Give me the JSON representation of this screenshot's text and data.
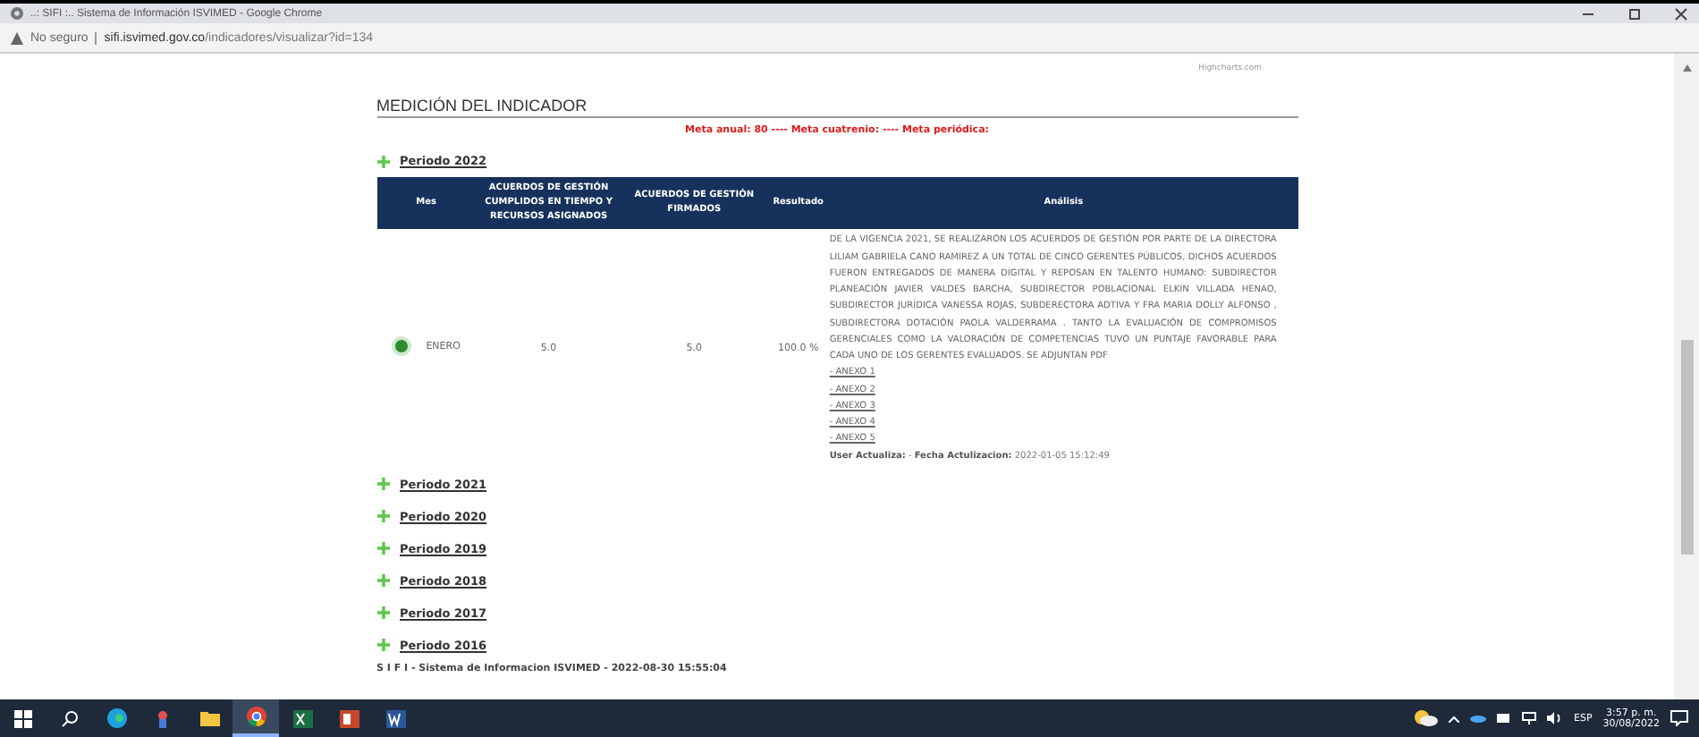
{
  "window": {
    "title": "..: SIFI :.. Sistema de Información ISVIMED - Google Chrome"
  },
  "address_bar": {
    "security": "No seguro",
    "host": "sifi.isvimed.gov.co",
    "path": "/indicadores/visualizar?id=134"
  },
  "chart_credit": "Highcharts.com",
  "section_title": "MEDICIÓN DEL INDICADOR",
  "goals": "Meta anual: 80 ---- Meta cuatrenio: ---- Meta periódica:",
  "periods": [
    {
      "label": "Periodo 2022",
      "table": {
        "columns": [
          "Mes",
          "ACUERDOS DE GESTIÓN CUMPLIDOS EN TIEMPO Y RECURSOS ASIGNADOS",
          "ACUERDOS DE GESTIÓN FIRMADOS",
          "Resultado",
          "Análisis"
        ],
        "rows": [
          {
            "color": "#2e8b2e",
            "mes": "ENERO",
            "cumplidos": "5.0",
            "firmados": "5.0",
            "resultado": "100.0 %",
            "analisis": "DE LA VIGENCIA 2021, SE REALIZARON LOS ACUERDOS DE GESTIÓN POR PARTE DE LA DIRECTORA LILIAM GABRIELA CANO RAMIREZ A UN TOTAL DE CINCO GERENTES PÚBLICOS, DICHOS ACUERDOS FUERON ENTREGADOS DE MANERA DIGITAL Y REPOSAN EN TALENTO HUMANO: SUBDIRECTOR PLANEACIÓN JAVIER VALDES BARCHA, SUBDIRECTOR POBLACIONAL ELKIN VILLADA HENAO, SUBDIRECTOR JURÍDICA VANESSA ROJAS, SUBDERECTORA ADTIVA Y FRA MARIA DOLLY ALFONSO , SUBDIRECTORA DOTACIÓN PAOLA VALDERRAMA . TANTO LA EVALUACIÓN DE COMPROMISOS GERENCIALES COMO LA VALORACIÓN DE COMPETENCIAS TUVO UN PUNTAJE FAVORABLE PARA CADA UNO DE LOS GERENTES EVALUADOS. SE ADJUNTAN PDF",
            "annexes": [
              "- ANEXO 1",
              "- ANEXO 2",
              "- ANEXO 3",
              "- ANEXO 4",
              "- ANEXO 5"
            ],
            "update": "**User Actualiza:** - **Fecha Actulizacion:** 2022-01-05 15:12:49"
          }
        ]
      }
    },
    {
      "label": "Periodo 2021"
    },
    {
      "label": "Periodo 2020"
    },
    {
      "label": "Periodo 2019"
    },
    {
      "label": "Periodo 2018"
    },
    {
      "label": "Periodo 2017"
    },
    {
      "label": "Periodo 2016"
    }
  ],
  "footer": "S I F I - Sistema de Informacion ISVIMED - 2022-08-30 15:55:04",
  "taskbar": {
    "apps": [
      {
        "kind": "start",
        "active": false
      },
      {
        "kind": "search",
        "active": false
      },
      {
        "kind": "edge",
        "active": false
      },
      {
        "kind": "app",
        "active": false
      },
      {
        "kind": "folder",
        "active": false
      },
      {
        "kind": "chrome",
        "active": true
      },
      {
        "kind": "excel",
        "active": false
      },
      {
        "kind": "powerpoint",
        "active": false
      },
      {
        "kind": "word",
        "active": false
      }
    ],
    "language": "ESP",
    "time": "3:57 p. m.",
    "date": "30/08/2022"
  }
}
